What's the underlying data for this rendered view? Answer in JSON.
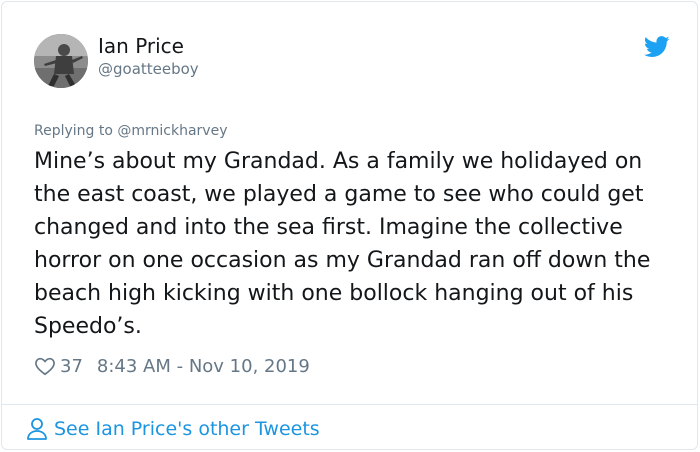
{
  "author": {
    "name": "Ian Price",
    "handle": "@goatteeboy"
  },
  "reply_context": "Replying to @mrnickharvey",
  "tweet_text": "Mine’s about my Grandad. As a family we holidayed on the east coast, we played a game to see who could get changed and into the sea first. Imagine the collective horror on one occasion as my Grandad ran off down the beach high kicking with one bollock hanging out of his Speedo’s.",
  "meta": {
    "likes": "37",
    "timestamp": "8:43 AM - Nov 10, 2019"
  },
  "footer": {
    "link_text": "See Ian Price's other Tweets"
  },
  "colors": {
    "accent": "#1da1f2",
    "link": "#1b95e0",
    "muted": "#657786",
    "text": "#14171a",
    "border": "#e1e8ed"
  },
  "icons": {
    "logo": "twitter-bird-icon",
    "like": "heart-icon",
    "profile": "person-icon"
  }
}
